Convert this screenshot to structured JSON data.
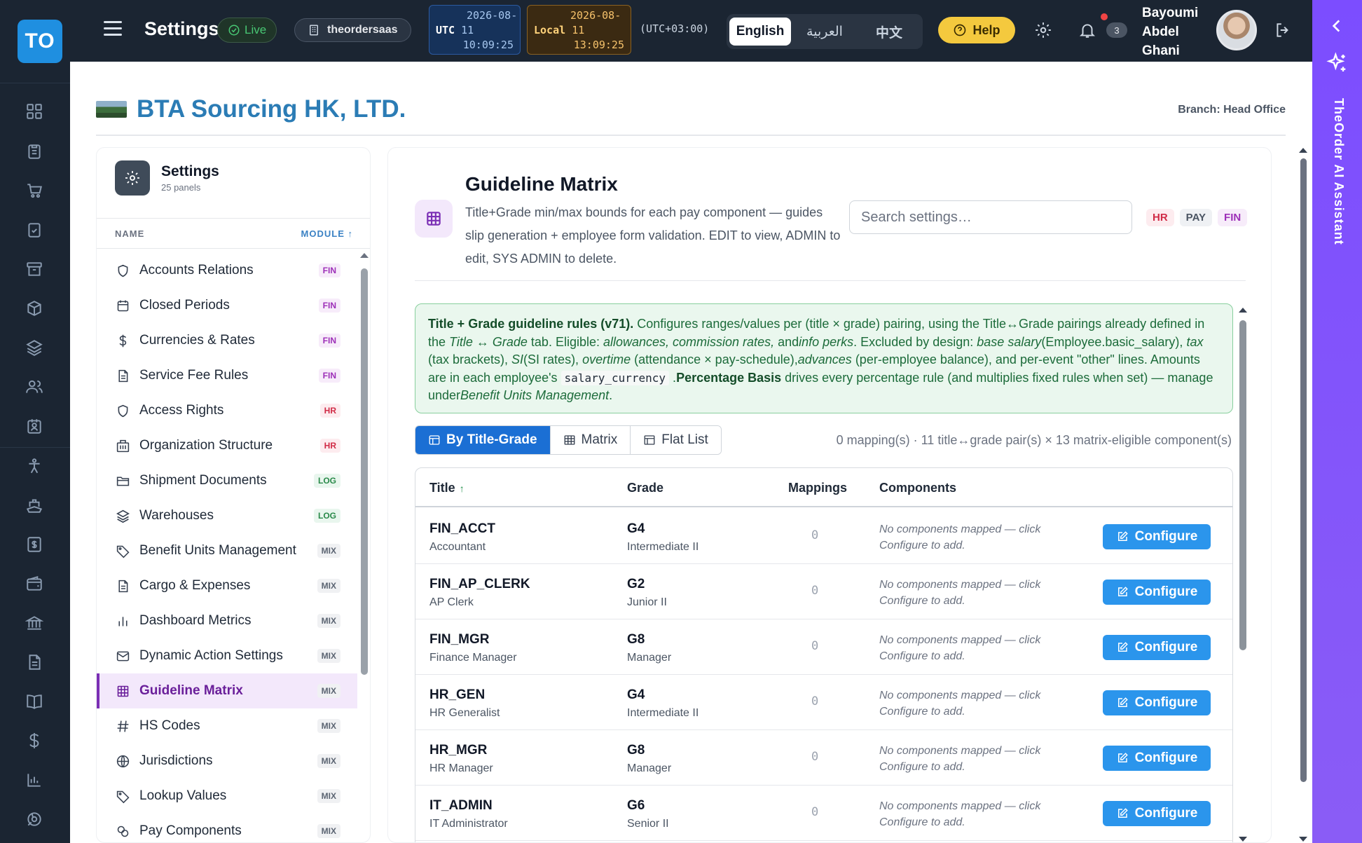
{
  "app": {
    "logo_text": "TO",
    "title": "Settings",
    "live_label": "Live",
    "tenant": "theordersaas",
    "clock_utc": {
      "tag": "UTC",
      "date_line1": "2026-08-",
      "date_line2": "11",
      "time": "10:09:25"
    },
    "clock_local": {
      "tag": "Local",
      "date_line1": "2026-08-",
      "date_line2": "11",
      "time": "13:09:25"
    },
    "timezone": "(UTC+03:00)",
    "languages": [
      "English",
      "العربية",
      "中文"
    ],
    "active_language": "English",
    "help_label": "Help",
    "notification_count": "3",
    "user_name": "Bayoumi Abdel Ghani",
    "ai_assistant_label": "TheOrder AI Assistant"
  },
  "rail_icons": [
    "dashboard-icon",
    "clipboard-icon",
    "cart-icon",
    "checklist-icon",
    "archive-icon",
    "box-icon",
    "layers-icon",
    "users-icon",
    "badge-icon",
    "person-icon",
    "ship-icon",
    "invoice-icon",
    "wallet-icon",
    "bank-icon",
    "document-icon",
    "book-icon",
    "dollar-icon",
    "chart-icon",
    "support-icon"
  ],
  "company": {
    "name": "BTA Sourcing HK, LTD.",
    "branch": "Branch: Head Office"
  },
  "settings_panel": {
    "title": "Settings",
    "subtitle": "25 panels",
    "col_name": "NAME",
    "col_module": "MODULE ↑",
    "items": [
      {
        "label": "Accounts Relations",
        "module": "FIN",
        "icon": "shield-icon"
      },
      {
        "label": "Closed Periods",
        "module": "FIN",
        "icon": "calendar-icon"
      },
      {
        "label": "Currencies & Rates",
        "module": "FIN",
        "icon": "dollar-icon"
      },
      {
        "label": "Service Fee Rules",
        "module": "FIN",
        "icon": "document-icon"
      },
      {
        "label": "Access Rights",
        "module": "HR",
        "icon": "shield-icon"
      },
      {
        "label": "Organization Structure",
        "module": "HR",
        "icon": "building-icon"
      },
      {
        "label": "Shipment Documents",
        "module": "LOG",
        "icon": "folder-icon"
      },
      {
        "label": "Warehouses",
        "module": "LOG",
        "icon": "layers-icon"
      },
      {
        "label": "Benefit Units Management",
        "module": "MIX",
        "icon": "tag-icon"
      },
      {
        "label": "Cargo & Expenses",
        "module": "MIX",
        "icon": "document-icon"
      },
      {
        "label": "Dashboard Metrics",
        "module": "MIX",
        "icon": "bar-chart-icon"
      },
      {
        "label": "Dynamic Action Settings",
        "module": "MIX",
        "icon": "mail-icon"
      },
      {
        "label": "Guideline Matrix",
        "module": "MIX",
        "icon": "grid-icon",
        "active": true
      },
      {
        "label": "HS Codes",
        "module": "MIX",
        "icon": "hash-icon"
      },
      {
        "label": "Jurisdictions",
        "module": "MIX",
        "icon": "globe-icon"
      },
      {
        "label": "Lookup Values",
        "module": "MIX",
        "icon": "tag-icon"
      },
      {
        "label": "Pay Components",
        "module": "MIX",
        "icon": "coins-icon"
      }
    ]
  },
  "main": {
    "title": "Guideline Matrix",
    "description": "Title+Grade min/max bounds for each pay component — guides slip generation + employee form validation. EDIT to view, ADMIN to edit, SYS ADMIN to delete.",
    "search_placeholder": "Search settings…",
    "badges": [
      "HR",
      "PAY",
      "FIN"
    ],
    "info": {
      "lead": "Title + Grade guideline rules (v71).",
      "text1": " Configures ranges/values per (title × grade) pairing, using the Title↔Grade pairings already defined in the ",
      "tab_ref": "Title ↔ Grade",
      "text2": " tab. Eligible: ",
      "eligible": "allowances, commission rates,",
      "text3": " and",
      "info_perks": "info perks",
      "text4": ". Excluded by design: ",
      "base_salary": "base salary",
      "text5": "(Employee.basic_salary), ",
      "tax": "tax",
      "text6": " (tax brackets), ",
      "si": "SI",
      "text7": "(SI rates), ",
      "overtime": "overtime",
      "text8": " (attendance × pay-schedule),",
      "advances": "advances",
      "text9": " (per-employee balance), and per-event \"other\" lines. Amounts are in each employee's ",
      "currency_field": "salary_currency",
      "text10": " .",
      "pct_basis": "Percentage Basis",
      "text11": " drives every percentage rule (and multiplies fixed rules when set) — manage under",
      "manage_link": "Benefit Units Management",
      "text12": "."
    },
    "tabs": [
      "By Title-Grade",
      "Matrix",
      "Flat List"
    ],
    "active_tab": "By Title-Grade",
    "summary": "0 mapping(s) · 11 title↔grade pair(s) × 13 matrix-eligible component(s)",
    "table": {
      "headers": {
        "title": "Title",
        "title_sort": "↑",
        "grade": "Grade",
        "mappings": "Mappings",
        "components": "Components"
      },
      "rows": [
        {
          "code": "FIN_ACCT",
          "title": "Accountant",
          "grade": "G4",
          "grade_name": "Intermediate II",
          "mappings": "0",
          "components": "No components mapped — click Configure to add.",
          "action": "Configure"
        },
        {
          "code": "FIN_AP_CLERK",
          "title": "AP Clerk",
          "grade": "G2",
          "grade_name": "Junior II",
          "mappings": "0",
          "components": "No components mapped — click Configure to add.",
          "action": "Configure"
        },
        {
          "code": "FIN_MGR",
          "title": "Finance Manager",
          "grade": "G8",
          "grade_name": "Manager",
          "mappings": "0",
          "components": "No components mapped — click Configure to add.",
          "action": "Configure"
        },
        {
          "code": "HR_GEN",
          "title": "HR Generalist",
          "grade": "G4",
          "grade_name": "Intermediate II",
          "mappings": "0",
          "components": "No components mapped — click Configure to add.",
          "action": "Configure"
        },
        {
          "code": "HR_MGR",
          "title": "HR Manager",
          "grade": "G8",
          "grade_name": "Manager",
          "mappings": "0",
          "components": "No components mapped — click Configure to add.",
          "action": "Configure"
        },
        {
          "code": "IT_ADMIN",
          "title": "IT Administrator",
          "grade": "G6",
          "grade_name": "Senior II",
          "mappings": "0",
          "components": "No components mapped — click Configure to add.",
          "action": "Configure"
        }
      ]
    }
  },
  "colors": {
    "topbar": "#1b2532",
    "brand_blue": "#1f8fe0",
    "company_blue": "#2b7cb5",
    "active_purple": "#7b2fb5",
    "info_green_bg": "#eaf7ee",
    "tab_active": "#1b6fd4",
    "configure_btn": "#2b95ec",
    "ai_strip": "#7c4dff",
    "help_yellow": "#f4c93e"
  }
}
